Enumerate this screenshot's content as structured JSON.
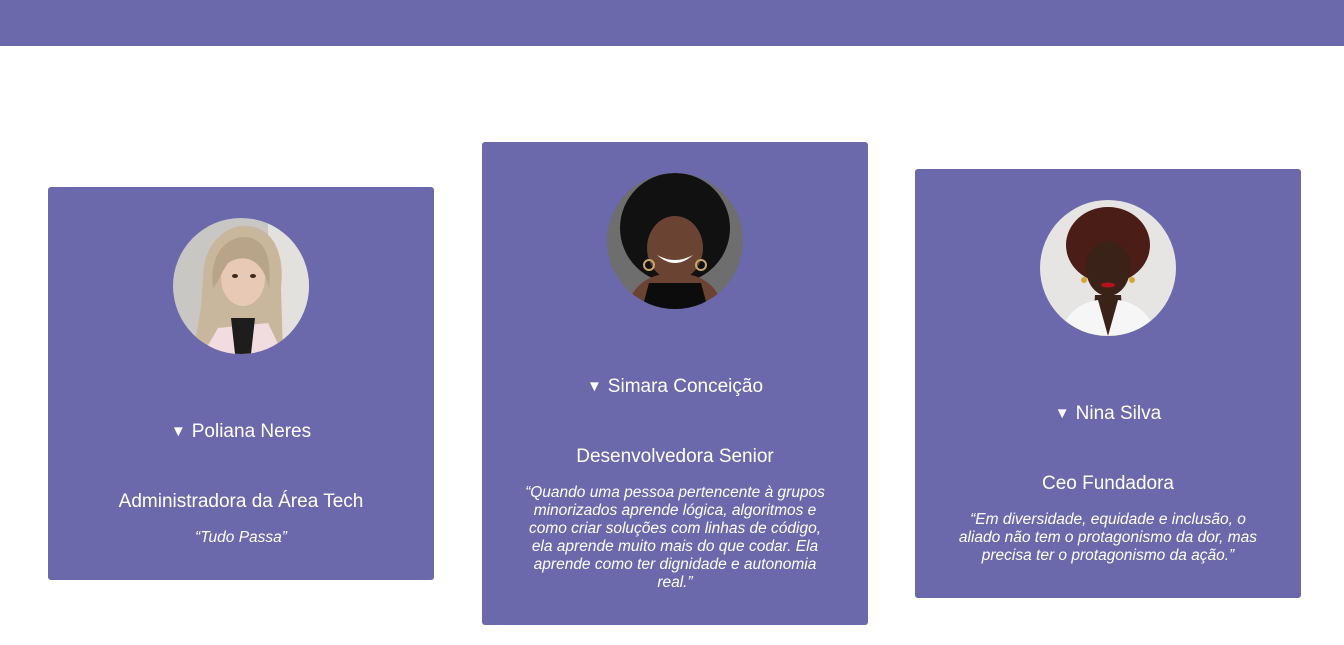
{
  "header": {
    "color": "#6b69ab"
  },
  "cards": [
    {
      "name": "Poliana Neres",
      "role": "Administradora da Área Tech",
      "quote": "“Tudo Passa”",
      "photo_icon": "portrait-photo"
    },
    {
      "name": "Simara Conceição",
      "role": "Desenvolvedora Senior",
      "quote": "“Quando uma pessoa pertencente à grupos minorizados aprende lógica, algoritmos e como criar soluções com linhas de código, ela aprende muito mais do que codar. Ela aprende como ter dignidade e autonomia real.”",
      "photo_icon": "portrait-photo"
    },
    {
      "name": "Nina Silva",
      "role": "Ceo Fundadora",
      "quote": "“Em diversidade, equidade e inclusão, o aliado não tem o protagonismo da dor, mas precisa ter o protagonismo da ação.”",
      "photo_icon": "portrait-photo"
    }
  ],
  "colors": {
    "card": "#6b69ab",
    "text": "#ffffff"
  },
  "disclosure_icon": "caret-down-icon"
}
